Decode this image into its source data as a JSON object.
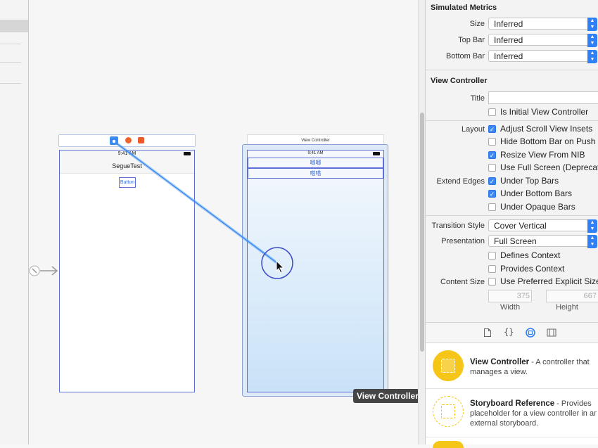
{
  "canvas": {
    "scene1": {
      "status_time": "9:41 AM",
      "nav_title": "SegueTest",
      "button_label": "Button"
    },
    "scene2": {
      "header_title": "View Controller",
      "status_time": "9:41 AM",
      "row1": "唧唧",
      "row2": "嗒嗒"
    },
    "tooltip": "View Controller"
  },
  "inspector": {
    "simulated_metrics": {
      "title": "Simulated Metrics",
      "size_label": "Size",
      "size_value": "Inferred",
      "top_bar_label": "Top Bar",
      "top_bar_value": "Inferred",
      "bottom_bar_label": "Bottom Bar",
      "bottom_bar_value": "Inferred"
    },
    "view_controller": {
      "title": "View Controller",
      "title_label": "Title",
      "title_value": "",
      "is_initial": "Is Initial View Controller",
      "layout_label": "Layout",
      "adjust_scroll": "Adjust Scroll View Insets",
      "hide_bottom": "Hide Bottom Bar on Push",
      "resize_view": "Resize View From NIB",
      "use_full_screen": "Use Full Screen (Deprecated)",
      "extend_edges_label": "Extend Edges",
      "under_top": "Under Top Bars",
      "under_bottom": "Under Bottom Bars",
      "under_opaque": "Under Opaque Bars",
      "transition_label": "Transition Style",
      "transition_value": "Cover Vertical",
      "presentation_label": "Presentation",
      "presentation_value": "Full Screen",
      "defines_context": "Defines Context",
      "provides_context": "Provides Context",
      "content_size_label": "Content Size",
      "use_preferred": "Use Preferred Explicit Size",
      "width_value": "375",
      "height_value": "667",
      "width_caption": "Width",
      "height_caption": "Height"
    },
    "checkboxes": {
      "is_initial": false,
      "adjust_scroll": true,
      "hide_bottom": false,
      "resize_view": true,
      "use_full_screen": false,
      "under_top": true,
      "under_bottom": true,
      "under_opaque": false,
      "defines_context": false,
      "provides_context": false,
      "use_preferred": false
    },
    "library_tabs": [
      "file-icon",
      "braces-icon",
      "object-library-icon",
      "media-library-icon"
    ],
    "library": [
      {
        "title": "View Controller",
        "desc1": " - A controller that",
        "desc2": "manages a view."
      },
      {
        "title": "Storyboard Reference",
        "desc1": " - Provides",
        "desc2": "placeholder for a view controller in an",
        "desc3": "external storyboard."
      }
    ]
  },
  "colors": {
    "accent": "#2f7ff5",
    "scene_border": "#5d6fd6",
    "library_icon": "#f5c518"
  }
}
